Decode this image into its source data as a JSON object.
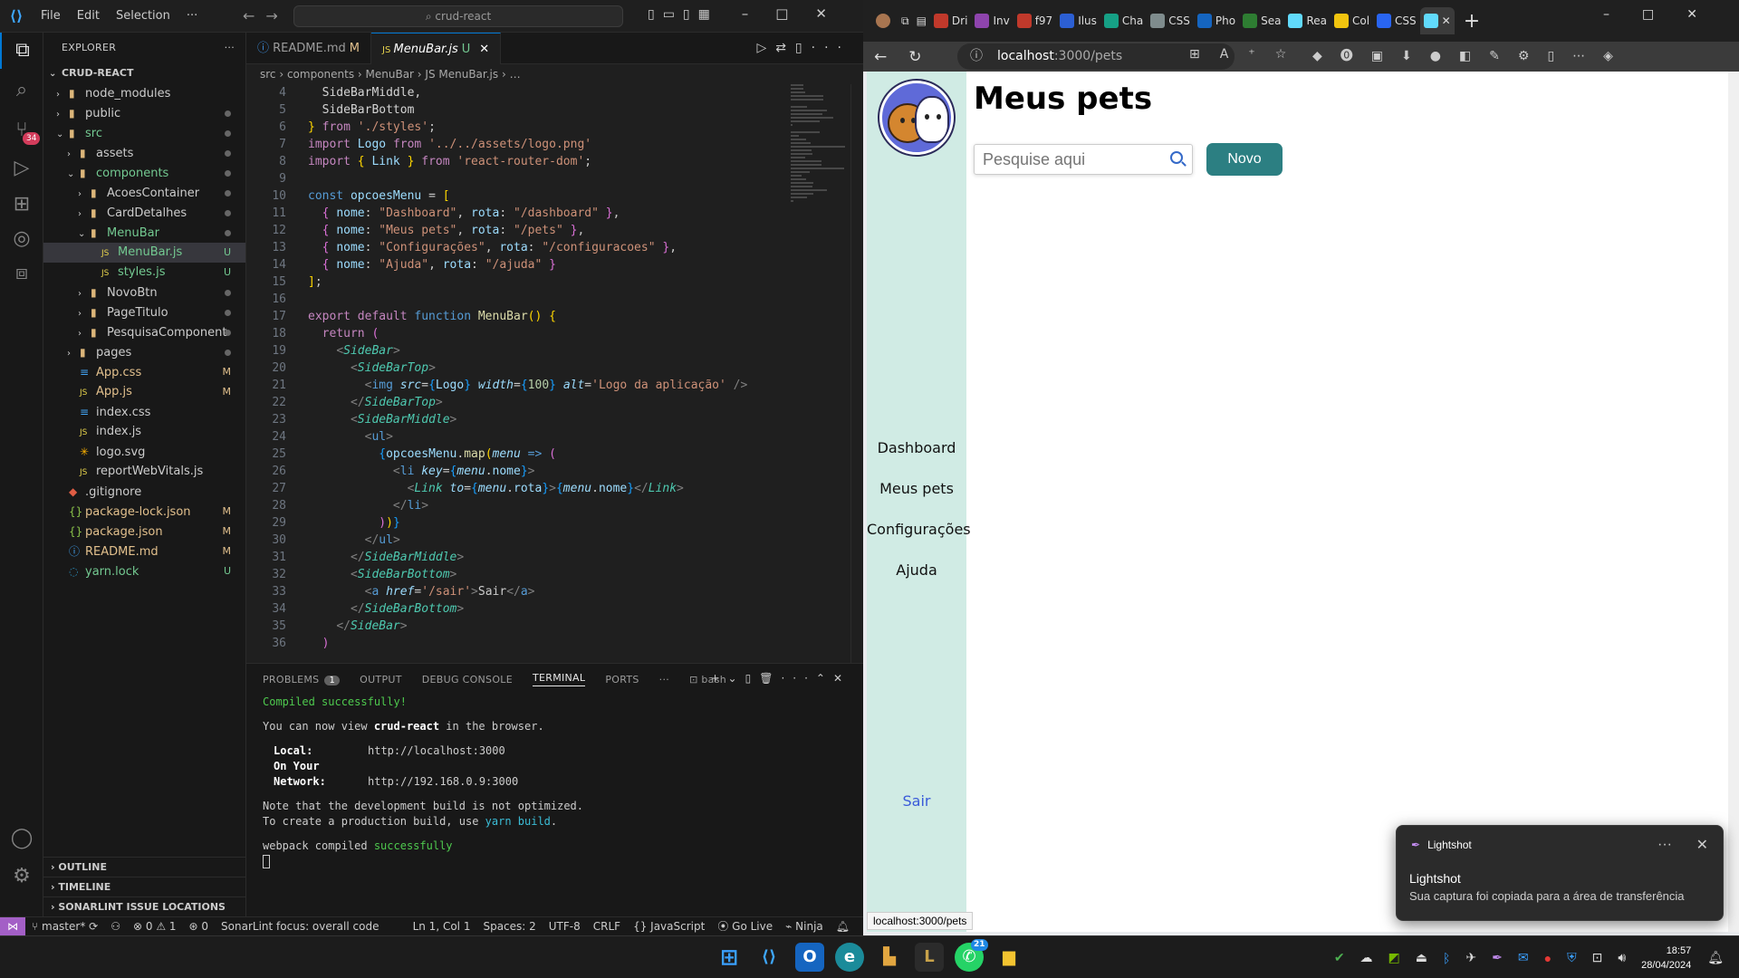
{
  "vscode": {
    "menu": [
      "File",
      "Edit",
      "Selection",
      "···"
    ],
    "search_text": "crud-react",
    "explorer_title": "EXPLORER",
    "project": "CRUD-REACT",
    "tree": [
      {
        "label": "node_modules",
        "depth": 1,
        "type": "folder",
        "status": "",
        "state": "collapsed"
      },
      {
        "label": "public",
        "depth": 1,
        "type": "folder",
        "status": "dot",
        "state": "collapsed"
      },
      {
        "label": "src",
        "depth": 1,
        "type": "folder",
        "status": "dot",
        "state": "expanded"
      },
      {
        "label": "assets",
        "depth": 2,
        "type": "folder",
        "status": "dot",
        "state": "collapsed"
      },
      {
        "label": "components",
        "depth": 2,
        "type": "folder",
        "status": "dot",
        "state": "expanded"
      },
      {
        "label": "AcoesContainer",
        "depth": 3,
        "type": "folder",
        "status": "dot",
        "state": "collapsed"
      },
      {
        "label": "CardDetalhes",
        "depth": 3,
        "type": "folder",
        "status": "dot",
        "state": "collapsed"
      },
      {
        "label": "MenuBar",
        "depth": 3,
        "type": "folder",
        "status": "dot",
        "state": "expanded"
      },
      {
        "label": "MenuBar.js",
        "depth": 4,
        "type": "js",
        "status": "U",
        "state": "file",
        "selected": true
      },
      {
        "label": "styles.js",
        "depth": 4,
        "type": "js",
        "status": "U",
        "state": "file"
      },
      {
        "label": "NovoBtn",
        "depth": 3,
        "type": "folder",
        "status": "dot",
        "state": "collapsed"
      },
      {
        "label": "PageTitulo",
        "depth": 3,
        "type": "folder",
        "status": "dot",
        "state": "collapsed"
      },
      {
        "label": "PesquisaComponent",
        "depth": 3,
        "type": "folder",
        "status": "dot",
        "state": "collapsed"
      },
      {
        "label": "pages",
        "depth": 2,
        "type": "folder",
        "status": "dot",
        "state": "collapsed"
      },
      {
        "label": "App.css",
        "depth": 2,
        "type": "css",
        "status": "M",
        "state": "file"
      },
      {
        "label": "App.js",
        "depth": 2,
        "type": "js",
        "status": "M",
        "state": "file"
      },
      {
        "label": "index.css",
        "depth": 2,
        "type": "css",
        "status": "",
        "state": "file"
      },
      {
        "label": "index.js",
        "depth": 2,
        "type": "js",
        "status": "",
        "state": "file"
      },
      {
        "label": "logo.svg",
        "depth": 2,
        "type": "svg",
        "status": "",
        "state": "file"
      },
      {
        "label": "reportWebVitals.js",
        "depth": 2,
        "type": "js",
        "status": "",
        "state": "file"
      },
      {
        "label": ".gitignore",
        "depth": 1,
        "type": "git",
        "status": "",
        "state": "file"
      },
      {
        "label": "package-lock.json",
        "depth": 1,
        "type": "json",
        "status": "M",
        "state": "file"
      },
      {
        "label": "package.json",
        "depth": 1,
        "type": "json",
        "status": "M",
        "state": "file"
      },
      {
        "label": "README.md",
        "depth": 1,
        "type": "md",
        "status": "M",
        "state": "file"
      },
      {
        "label": "yarn.lock",
        "depth": 1,
        "type": "yarn",
        "status": "U",
        "state": "file"
      }
    ],
    "sections": [
      "OUTLINE",
      "TIMELINE",
      "SONARLINT ISSUE LOCATIONS"
    ],
    "tabs": [
      {
        "label": "README.md",
        "flag": "M"
      },
      {
        "label": "MenuBar.js",
        "flag": "U"
      }
    ],
    "breadcrumb": "src  ›  components  ›  MenuBar  ›  JS  MenuBar.js  ›  …",
    "code_lines": [
      {
        "n": "4",
        "html": "  <span class='op'>SideBarMiddle,</span>"
      },
      {
        "n": "5",
        "html": "  <span class='op'>SideBarBottom</span>"
      },
      {
        "n": "6",
        "html": "<span class='br1'>}</span> <span class='kw'>from</span> <span class='str'>'./styles'</span>;"
      },
      {
        "n": "7",
        "html": "<span class='kw'>import</span> <span class='var'>Logo</span> <span class='kw'>from</span> <span class='str'>'../../assets/logo.png'</span>"
      },
      {
        "n": "8",
        "html": "<span class='kw'>import</span> <span class='br1'>{</span> <span class='var'>Link</span> <span class='br1'>}</span> <span class='kw'>from</span> <span class='str'>'react-router-dom'</span>;"
      },
      {
        "n": "9",
        "html": ""
      },
      {
        "n": "10",
        "html": "<span class='kwb'>const</span> <span class='var'>opcoesMenu</span> = <span class='br1'>[</span>"
      },
      {
        "n": "11",
        "html": "  <span class='br2'>{</span> <span class='var'>nome</span>: <span class='str'>\"Dashboard\"</span>, <span class='var'>rota</span>: <span class='str'>\"/dashboard\"</span> <span class='br2'>}</span>,"
      },
      {
        "n": "12",
        "html": "  <span class='br2'>{</span> <span class='var'>nome</span>: <span class='str'>\"Meus pets\"</span>, <span class='var'>rota</span>: <span class='str'>\"/pets\"</span> <span class='br2'>}</span>,"
      },
      {
        "n": "13",
        "html": "  <span class='br2'>{</span> <span class='var'>nome</span>: <span class='str'>\"Configurações\"</span>, <span class='var'>rota</span>: <span class='str'>\"/configuracoes\"</span> <span class='br2'>}</span>,"
      },
      {
        "n": "14",
        "html": "  <span class='br2'>{</span> <span class='var'>nome</span>: <span class='str'>\"Ajuda\"</span>, <span class='var'>rota</span>: <span class='str'>\"/ajuda\"</span> <span class='br2'>}</span>"
      },
      {
        "n": "15",
        "html": "<span class='br1'>]</span>;"
      },
      {
        "n": "16",
        "html": ""
      },
      {
        "n": "17",
        "html": "<span class='kw'>export default</span> <span class='kwb'>function</span> <span class='fn'>MenuBar</span><span class='br1'>()</span> <span class='br1'>{</span>"
      },
      {
        "n": "18",
        "html": "  <span class='kw'>return</span> <span class='br2'>(</span>"
      },
      {
        "n": "19",
        "html": "    <span class='jsx'>&lt;</span><span class='tag'><i>SideBar</i></span><span class='jsx'>&gt;</span>"
      },
      {
        "n": "20",
        "html": "      <span class='jsx'>&lt;</span><span class='tag'><i>SideBarTop</i></span><span class='jsx'>&gt;</span>"
      },
      {
        "n": "21",
        "html": "        <span class='jsx'>&lt;</span><span class='kwb'>img</span> <span class='var'><i>src</i></span>=<span class='br3'>{</span><span class='var'>Logo</span><span class='br3'>}</span> <span class='var'><i>width</i></span>=<span class='br3'>{</span><span class='num'>100</span><span class='br3'>}</span> <span class='var'><i>alt</i></span>=<span class='str'>'Logo da aplicação'</span> <span class='jsx'>/&gt;</span>"
      },
      {
        "n": "22",
        "html": "      <span class='jsx'>&lt;/</span><span class='tag'><i>SideBarTop</i></span><span class='jsx'>&gt;</span>"
      },
      {
        "n": "23",
        "html": "      <span class='jsx'>&lt;</span><span class='tag'><i>SideBarMiddle</i></span><span class='jsx'>&gt;</span>"
      },
      {
        "n": "24",
        "html": "        <span class='jsx'>&lt;</span><span class='kwb'>ul</span><span class='jsx'>&gt;</span>"
      },
      {
        "n": "25",
        "html": "          <span class='br3'>{</span><span class='var'>opcoesMenu</span>.<span class='fn'>map</span><span class='br1'>(</span><span class='var'><i>menu</i></span> <span class='kwb'>=&gt;</span> <span class='br2'>(</span>"
      },
      {
        "n": "26",
        "html": "            <span class='jsx'>&lt;</span><span class='kwb'>li</span> <span class='var'><i>key</i></span>=<span class='br3'>{</span><span class='var'><i>menu</i></span>.<span class='var'>nome</span><span class='br3'>}</span><span class='jsx'>&gt;</span>"
      },
      {
        "n": "27",
        "html": "              <span class='jsx'>&lt;</span><span class='tag'><i>Link</i></span> <span class='var'><i>to</i></span>=<span class='br3'>{</span><span class='var'><i>menu</i></span>.<span class='var'>rota</span><span class='br3'>}</span><span class='jsx'>&gt;</span><span class='br3'>{</span><span class='var'><i>menu</i></span>.<span class='var'>nome</span><span class='br3'>}</span><span class='jsx'>&lt;/</span><span class='tag'><i>Link</i></span><span class='jsx'>&gt;</span>"
      },
      {
        "n": "28",
        "html": "            <span class='jsx'>&lt;/</span><span class='kwb'>li</span><span class='jsx'>&gt;</span>"
      },
      {
        "n": "29",
        "html": "          <span class='br2'>)</span><span class='br1'>)</span><span class='br3'>}</span>"
      },
      {
        "n": "30",
        "html": "        <span class='jsx'>&lt;/</span><span class='kwb'>ul</span><span class='jsx'>&gt;</span>"
      },
      {
        "n": "31",
        "html": "      <span class='jsx'>&lt;/</span><span class='tag'><i>SideBarMiddle</i></span><span class='jsx'>&gt;</span>"
      },
      {
        "n": "32",
        "html": "      <span class='jsx'>&lt;</span><span class='tag'><i>SideBarBottom</i></span><span class='jsx'>&gt;</span>"
      },
      {
        "n": "33",
        "html": "        <span class='jsx'>&lt;</span><span class='kwb'>a</span> <span class='var'><i>href</i></span>=<span class='str'>'/sair'</span><span class='jsx'>&gt;</span>Sair<span class='jsx'>&lt;/</span><span class='kwb'>a</span><span class='jsx'>&gt;</span>"
      },
      {
        "n": "34",
        "html": "      <span class='jsx'>&lt;/</span><span class='tag'><i>SideBarBottom</i></span><span class='jsx'>&gt;</span>"
      },
      {
        "n": "35",
        "html": "    <span class='jsx'>&lt;/</span><span class='tag'><i>SideBar</i></span><span class='jsx'>&gt;</span>"
      },
      {
        "n": "36",
        "html": "  <span class='br2'>)</span>"
      }
    ],
    "panel_tabs": [
      "PROBLEMS",
      "OUTPUT",
      "DEBUG CONSOLE",
      "TERMINAL",
      "PORTS"
    ],
    "problems_count": "1",
    "terminal_shell": "bash",
    "terminal": {
      "compiled": "Compiled successfully!",
      "view_pre": "You can now view ",
      "app_name": "crud-react",
      "view_post": " in the browser.",
      "local_label": "Local:",
      "local_url": "http://localhost:3000",
      "network_label": "On Your Network:",
      "network_url": "http://192.168.0.9:3000",
      "note1": "Note that the development build is not optimized.",
      "note2_pre": "To create a production build, use ",
      "note2_cmd": "yarn build",
      "note2_post": ".",
      "webpack_pre": "webpack compiled ",
      "webpack_ok": "successfully"
    },
    "status": {
      "branch": "master*",
      "errors": "0",
      "warnings": "1",
      "ports": "0",
      "sonar": "SonarLint focus: overall code",
      "position": "Ln 1, Col 1",
      "spaces": "Spaces: 2",
      "encoding": "UTF-8",
      "eol": "CRLF",
      "language": "JavaScript",
      "golive": "Go Live",
      "ninja": "Ninja"
    },
    "source_control_badge": "34"
  },
  "edge": {
    "tabs": [
      "Dri",
      "Inv",
      "f97",
      "Ilus",
      "Cha",
      "CSS",
      "Pho",
      "Sea",
      "Rea",
      "Col",
      "CSS",
      ""
    ],
    "url_host": "localhost",
    "url_path": ":3000/pets",
    "hover_url": "localhost:3000/pets"
  },
  "app": {
    "menu": [
      "Dashboard",
      "Meus pets",
      "Configurações",
      "Ajuda"
    ],
    "logout": "Sair",
    "page_title": "Meus pets",
    "search_placeholder": "Pesquise aqui",
    "new_button": "Novo"
  },
  "toast": {
    "app": "Lightshot",
    "title": "Lightshot",
    "body": "Sua captura foi copiada para a área de transferência"
  },
  "taskbar": {
    "apps": [
      "windows-start",
      "vscode",
      "outlook",
      "edge",
      "bash",
      "league",
      "whatsapp",
      "file-explorer"
    ],
    "whatsapp_badge": "21",
    "time": "18:57",
    "date": "28/04/2024"
  },
  "colors": {
    "vscode_accent": "#0078d4",
    "sidebar_bg": "#d0ebe4",
    "new_button": "#2c7f82",
    "logout_link": "#3a5bd9"
  }
}
